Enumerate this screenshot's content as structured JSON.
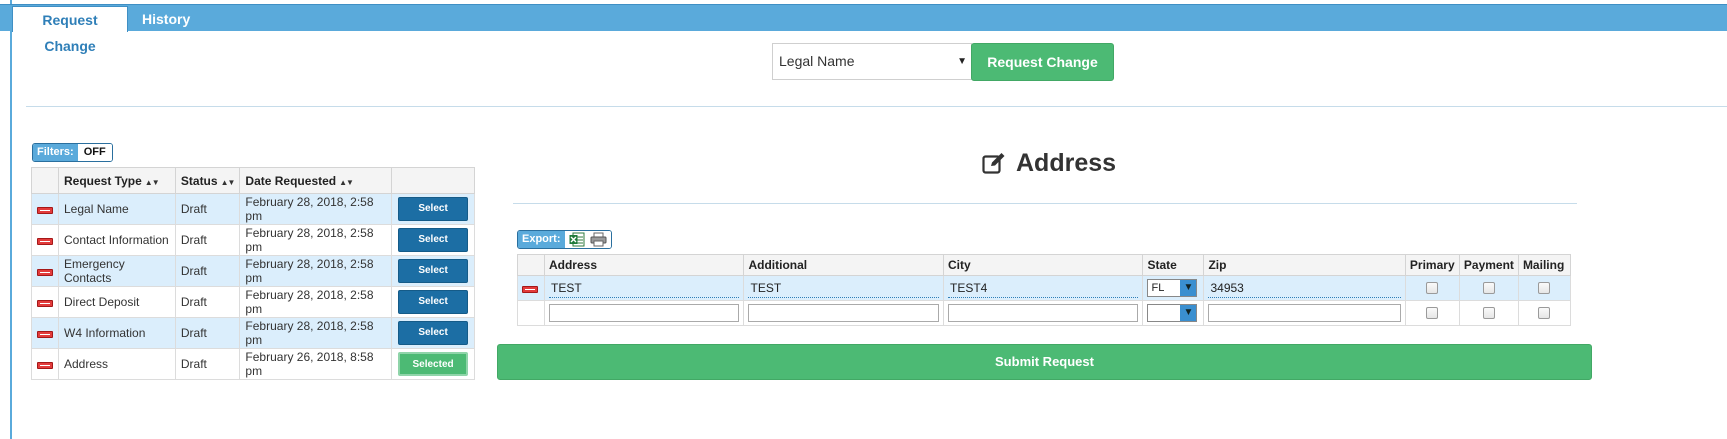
{
  "tabs": [
    {
      "label": "Request Change",
      "active": true
    },
    {
      "label": "History",
      "active": false
    }
  ],
  "request_type_select": {
    "value": "Legal Name"
  },
  "request_change_button": "Request Change",
  "filters": {
    "label": "Filters:",
    "state": "OFF"
  },
  "requests_table": {
    "headers": [
      "Request Type",
      "Status",
      "Date Requested"
    ],
    "rows": [
      {
        "type": "Legal Name",
        "status": "Draft",
        "date": "February 28, 2018, 2:58 pm",
        "action": "Select"
      },
      {
        "type": "Contact Information",
        "status": "Draft",
        "date": "February 28, 2018, 2:58 pm",
        "action": "Select"
      },
      {
        "type": "Emergency Contacts",
        "status": "Draft",
        "date": "February 28, 2018, 2:58 pm",
        "action": "Select"
      },
      {
        "type": "Direct Deposit",
        "status": "Draft",
        "date": "February 28, 2018, 2:58 pm",
        "action": "Select"
      },
      {
        "type": "W4 Information",
        "status": "Draft",
        "date": "February 28, 2018, 2:58 pm",
        "action": "Select"
      },
      {
        "type": "Address",
        "status": "Draft",
        "date": "February 26, 2018, 8:58 pm",
        "action": "Selected"
      }
    ]
  },
  "detail": {
    "title": "Address",
    "export_label": "Export:",
    "headers": [
      "Address",
      "Additional",
      "City",
      "State",
      "Zip",
      "Primary",
      "Payment",
      "Mailing"
    ],
    "row": {
      "address": "TEST",
      "additional": "TEST",
      "city": "TEST4",
      "state": "FL",
      "zip": "34953"
    }
  },
  "submit_button": "Submit Request",
  "colors": {
    "accent": "#5aaadb",
    "primary_button": "#1c6ea4",
    "success": "#4cba74",
    "row_highlight": "#dbeefc"
  }
}
